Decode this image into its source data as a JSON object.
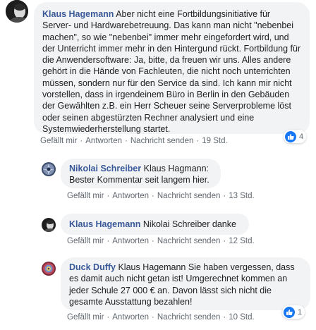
{
  "comments": [
    {
      "author": "Klaus Hagemann",
      "text": "Aber nicht eine Fortbildungsinitiative für Server- und Hardwarebetreuung. Das kann man nicht \"nebenbei machen\", so wie \"nebenbei\" immer mehr eingefordert wird, und der Unterricht immer mehr in den Hintergund rückt. Fortbildung für die Anwendersoftware: Ja, bitte, da freuen wir uns. Alles andere gehört in die Hände von Fachleuten, die nicht noch unterrichten müssen, sondern nur für den Service da sind. Ich kann mir nicht vorstellen, dass in irgendeinem Büro in Berlin in den Gebäuden der Gewählten z.B. ein Herr Scheuer seine Serverprobleme löst oder seinen abgestürzten Rechner analysiert und eine Systemwiederherstellung startet.",
      "like": "Gefällt mir",
      "reply": "Antworten",
      "send_message": "Nachricht senden",
      "time": "19 Std.",
      "reaction_count": "4"
    },
    {
      "author": "Nikolai Schreiber",
      "text": "Klaus Hagmann: Bester Kommentar seit langem hier.",
      "like": "Gefällt mir",
      "reply": "Antworten",
      "send_message": "Nachricht senden",
      "time": "13 Std."
    },
    {
      "author": "Klaus Hagemann",
      "text": "Nikolai Schreiber danke",
      "like": "Gefällt mir",
      "reply": "Antworten",
      "send_message": "Nachricht senden",
      "time": "12 Std."
    },
    {
      "author": "Duck Duffy",
      "text": "Klaus Hagemann Sie haben vergessen, dass es damit auch nicht getan ist! Umgerechnet kommen an jeder Schule 27 000 € an. Davon lässt sich nicht die gesamte Ausstattung bezahlen!",
      "like": "Gefällt mir",
      "reply": "Antworten",
      "send_message": "Nachricht senden",
      "time": "10 Std.",
      "reaction_count": "1"
    }
  ],
  "separator": "·",
  "colors": {
    "author": "#385898",
    "bubble": "#f2f3f5",
    "meta": "#606770",
    "like_blue": "#1877f2"
  }
}
